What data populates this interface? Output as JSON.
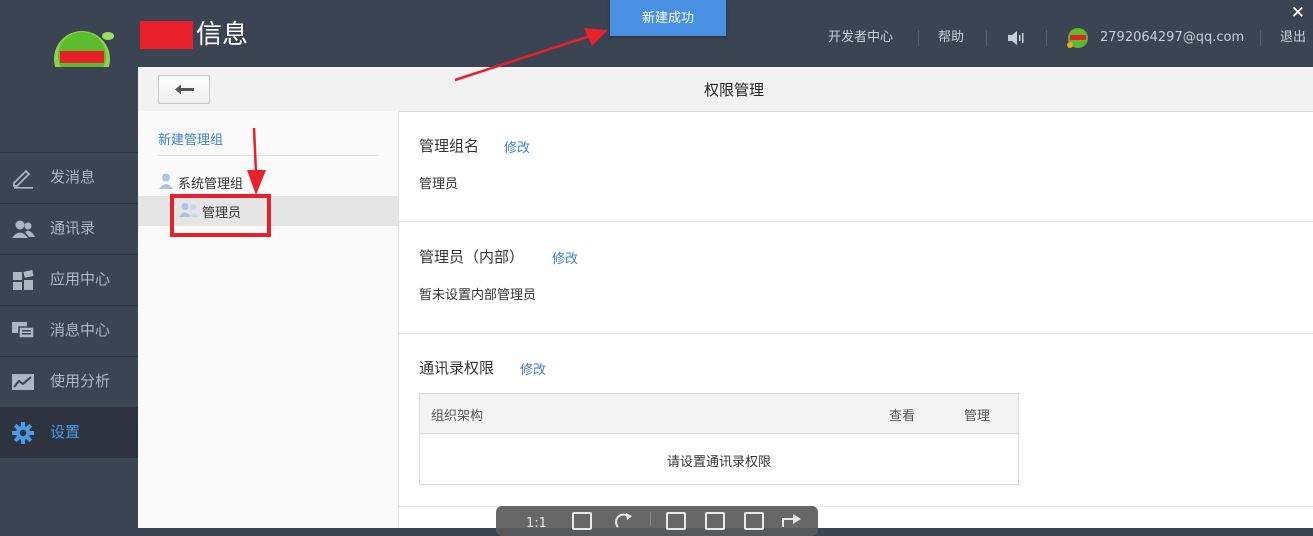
{
  "header": {
    "app_title": "信息",
    "toast": "新建成功",
    "nav": {
      "developer": "开发者中心",
      "help": "帮助",
      "account": "2792064297@qq.com",
      "logout": "退出"
    },
    "close_glyph": "✕"
  },
  "sidebar": {
    "items": [
      {
        "label": "发消息",
        "icon": "pencil-icon"
      },
      {
        "label": "通讯录",
        "icon": "contacts-icon"
      },
      {
        "label": "应用中心",
        "icon": "apps-icon"
      },
      {
        "label": "消息中心",
        "icon": "messages-icon"
      },
      {
        "label": "使用分析",
        "icon": "analytics-icon"
      },
      {
        "label": "设置",
        "icon": "gear-icon",
        "active": true
      }
    ]
  },
  "panel": {
    "title": "权限管理",
    "back_glyph": "←"
  },
  "groups": {
    "new_group": "新建管理组",
    "tree_parent": "系统管理组",
    "tree_child": "管理员"
  },
  "detail": {
    "group_name": {
      "title": "管理组名",
      "edit": "修改",
      "value": "管理员"
    },
    "admins": {
      "title": "管理员（内部）",
      "edit": "修改",
      "value": "暂未设置内部管理员"
    },
    "contacts_perm": {
      "title": "通讯录权限",
      "edit": "修改",
      "columns": [
        "组织架构",
        "查看",
        "管理"
      ],
      "empty": "请设置通讯录权限"
    }
  },
  "toolbar": {
    "zoom_label": "1:1"
  },
  "colors": {
    "sidebar_bg": "#3b4452",
    "accent": "#4a90e2",
    "link": "#3a7fcc",
    "annotation": "#e8202b"
  }
}
